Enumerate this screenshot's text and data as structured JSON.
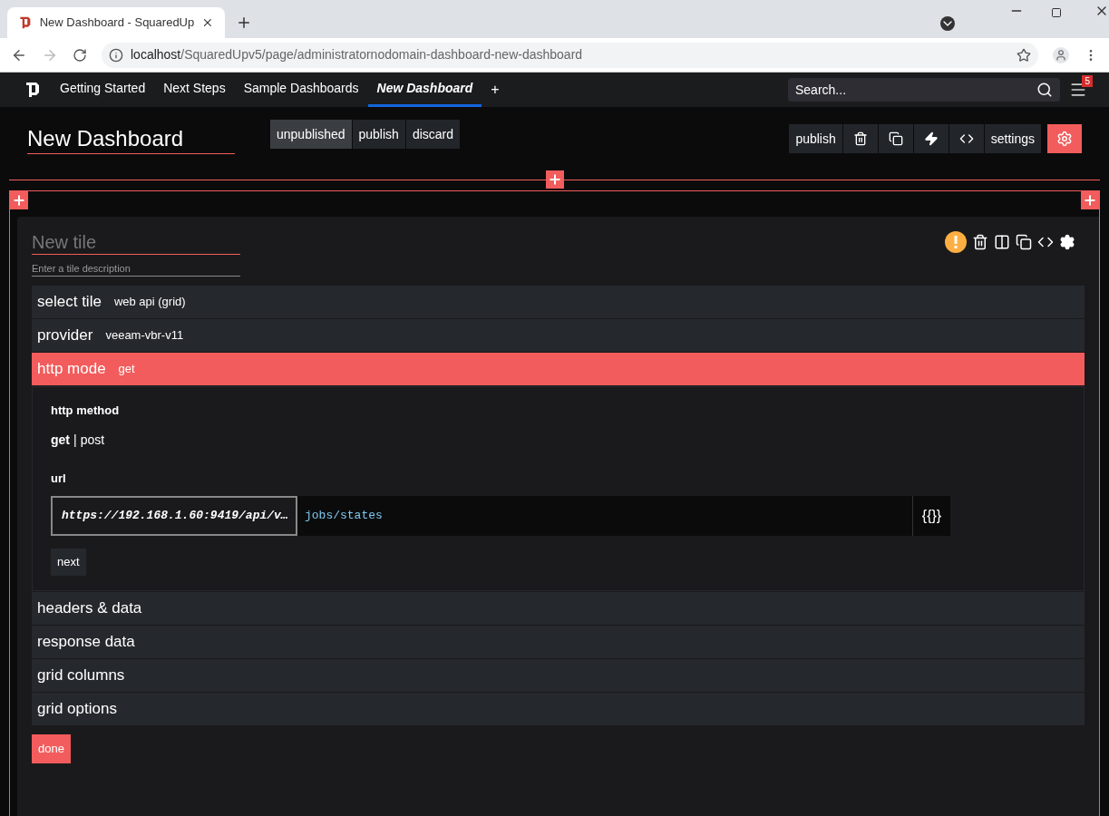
{
  "browser": {
    "tab_title": "New Dashboard - SquaredUp",
    "url_host": "localhost",
    "url_path": "/SquaredUpv5/page/administratornodomain-dashboard-new-dashboard"
  },
  "nav": {
    "items": [
      {
        "label": "Getting Started",
        "selected": false
      },
      {
        "label": "Next Steps",
        "selected": false
      },
      {
        "label": "Sample Dashboards",
        "selected": false
      },
      {
        "label": "New Dashboard",
        "selected": true
      }
    ],
    "add": "+",
    "search_placeholder": "Search...",
    "notification_count": "5"
  },
  "dashboard": {
    "title": "New Dashboard",
    "states": [
      {
        "label": "unpublished",
        "selected": true
      },
      {
        "label": "publish",
        "selected": false
      },
      {
        "label": "discard",
        "selected": false
      }
    ],
    "toolbar": {
      "publish": "publish",
      "settings": "settings"
    }
  },
  "tile": {
    "title_placeholder": "New tile",
    "description_placeholder": "Enter a tile description",
    "sections": [
      {
        "label": "select tile",
        "value": "web api (grid)",
        "expanded": false
      },
      {
        "label": "provider",
        "value": "veeam-vbr-v11",
        "expanded": false
      },
      {
        "label": "http mode",
        "value": "get",
        "expanded": true
      },
      {
        "label": "headers & data",
        "expanded": false
      },
      {
        "label": "response data",
        "expanded": false
      },
      {
        "label": "grid columns",
        "expanded": false
      },
      {
        "label": "grid options",
        "expanded": false
      }
    ],
    "http_method_label": "http method",
    "methods": [
      {
        "label": "get",
        "selected": true
      },
      {
        "label": "post",
        "selected": false
      }
    ],
    "separator": "|",
    "url_label": "url",
    "url_base": "https://192.168.1.60:9419/api/v…",
    "url_path": "jobs/states",
    "template_button": "{{}}",
    "next": "next",
    "done": "done"
  }
}
